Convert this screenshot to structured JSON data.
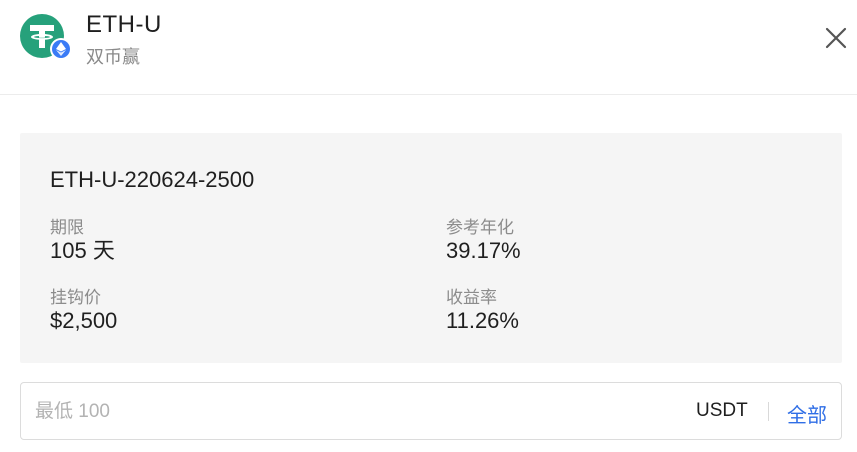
{
  "header": {
    "title": "ETH-U",
    "subtitle": "双币赢",
    "logo_icon": "tether-usdt-icon",
    "badge_icon": "ethereum-icon",
    "close_icon": "close-icon"
  },
  "product": {
    "code": "ETH-U-220624-2500",
    "stats": [
      {
        "label": "期限",
        "value": "105 天"
      },
      {
        "label": "参考年化",
        "value": "39.17%"
      },
      {
        "label": "挂钩价",
        "value": "$2,500"
      },
      {
        "label": "收益率",
        "value": "11.26%"
      }
    ]
  },
  "amount_input": {
    "placeholder": "最低 100",
    "value": "",
    "unit": "USDT",
    "max_label": "全部"
  },
  "colors": {
    "tether_green": "#26a17b",
    "eth_badge_blue": "#3a7bf6",
    "link_blue": "#2f6ee6",
    "card_bg": "#f5f5f5"
  }
}
